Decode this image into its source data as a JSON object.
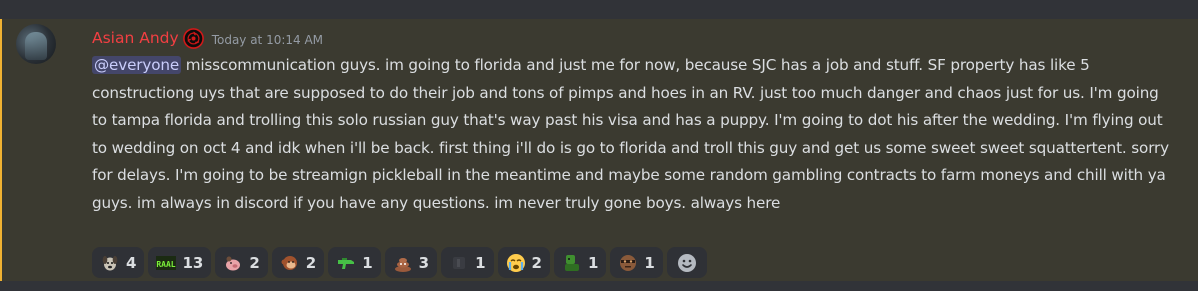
{
  "message": {
    "username": "Asian Andy",
    "timestamp": "Today at 10:14 AM",
    "mention": "@everyone",
    "text": " misscommunication guys. im going to florida and just me for now, because SJC has a job and stuff. SF property has like 5 constructiong uys that are supposed to do their job and tons of pimps and hoes in an RV. just too much danger and chaos just for us. I'm going to tampa florida and trolling this solo russian guy that's way past his visa and has a puppy. I'm going to dot his after the wedding. I'm flying out to wedding on oct 4 and idk when i'll be back. first thing i'll do is go to florida and troll this guy and get us some sweet sweet squattertent. sorry for delays. I'm going to be streamign pickleball in the meantime and maybe some random gambling contracts to farm moneys and chill with ya guys. im always in discord if you have any questions. im never truly gone boys. always here"
  },
  "colors": {
    "username": "#f23f42",
    "highlight_bg": "#3b3a30",
    "accent_bar": "#f0b232",
    "mention_bg": "rgba(88,101,242,0.3)"
  },
  "reactions": [
    {
      "icon": "dog-emoji",
      "count": "4"
    },
    {
      "icon": "raal-text-emoji",
      "count": "13"
    },
    {
      "icon": "pink-pig-emoji",
      "count": "2"
    },
    {
      "icon": "monkey-emoji",
      "count": "2"
    },
    {
      "icon": "water-gun-emoji",
      "count": "1"
    },
    {
      "icon": "poop-emoji",
      "count": "3"
    },
    {
      "icon": "dark-emoji",
      "count": "1"
    },
    {
      "icon": "crying-face-emoji",
      "count": "2"
    },
    {
      "icon": "green-character-emoji",
      "count": "1"
    },
    {
      "icon": "face-emoji",
      "count": "1"
    }
  ]
}
